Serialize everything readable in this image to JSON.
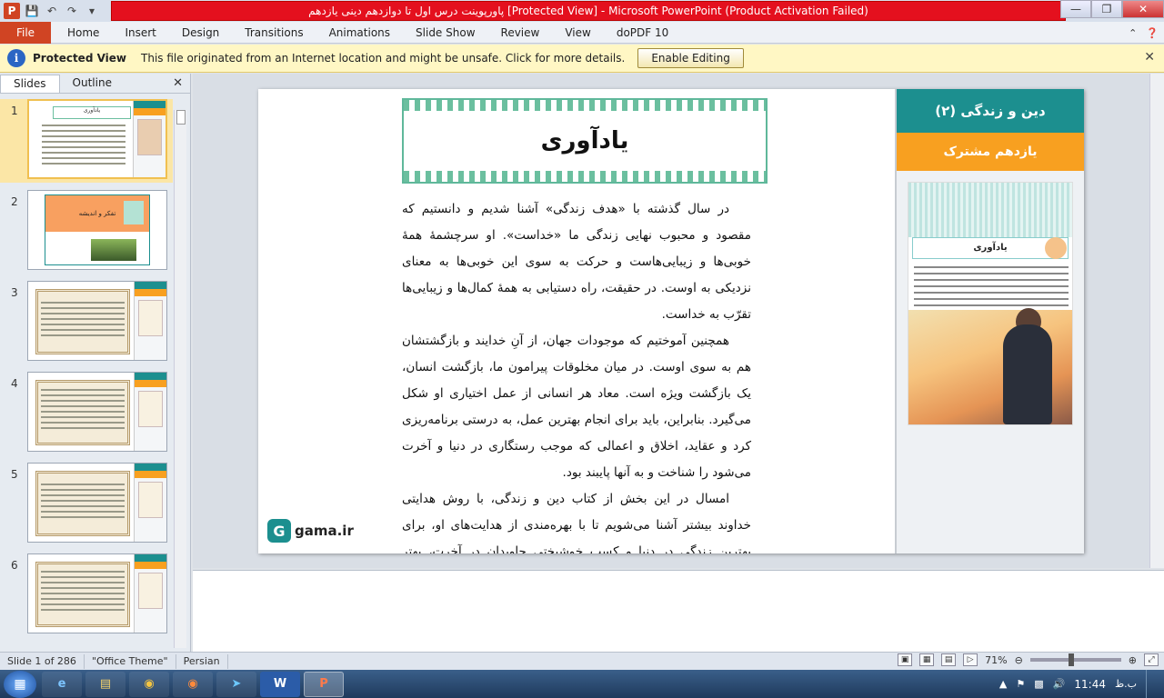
{
  "window": {
    "title": "پاورپوینت درس اول تا دوازدهم دینی یازدهم [Protected View] - Microsoft PowerPoint (Product Activation Failed)"
  },
  "qat": {
    "app_icon": "P"
  },
  "ribbon": {
    "tabs": [
      "File",
      "Home",
      "Insert",
      "Design",
      "Transitions",
      "Animations",
      "Slide Show",
      "Review",
      "View",
      "doPDF 10"
    ]
  },
  "protected_view": {
    "label": "Protected View",
    "message": "This file originated from an Internet location and might be unsafe. Click for more details.",
    "button": "Enable Editing"
  },
  "left_panel": {
    "tabs": [
      "Slides",
      "Outline"
    ],
    "thumb2_title": "تفکر و اندیشه",
    "slide_numbers": [
      "1",
      "2",
      "3",
      "4",
      "5",
      "6"
    ]
  },
  "slide": {
    "title": "یادآوری",
    "side_title": "دین و زندگی (۲)",
    "side_subtitle": "یازدهم مشترک",
    "pic_title": "یادآوری",
    "paragraphs": [
      "در سال گذشته با «هدف زندگی» آشنا شدیم و دانستیم که مقصود و محبوب نهایی زندگی ما «خداست». او سرچشمهٔ همهٔ خوبی‌ها و زیبایی‌هاست و حرکت به سوی این خوبی‌ها به معنای نزدیکی به اوست. در حقیقت، راه دستیابی به همهٔ کمال‌ها و زیبایی‌ها تقرّب به خداست.",
      "همچنین آموختیم که موجودات جهان، از آنِ خدایند و بازگشتشان هم به سوی اوست. در میان مخلوقات پیرامون ما، بازگشت انسان، یک بازگشت ویژه است. معاد هر انسانی از عمل اختیاری او شکل می‌گیرد. بنابراین، باید برای انجام بهترین عمل، به درستی برنامه‌ریزی کرد و عقاید، اخلاق و اعمالی که موجب رستگاری در دنیا و آخرت می‌شود را شناخت و به آنها پایبند بود.",
      "امسال در این بخش از کتاب دین و زندگی، با روش هدایتی خداوند بیشتر آشنا می‌شویم تا با بهره‌مندی از هدایت‌های او، برای بهترین زندگی در دنیا و کسب خوشبختی جاویدان در آخرت، بهتر برنامه‌ریزی کنیم."
    ],
    "logo_text": "gama.ir"
  },
  "status": {
    "slide_info": "Slide 1 of 286",
    "theme": "\"Office Theme\"",
    "language": "Persian",
    "zoom": "71%",
    "zoom_fraction": 0.45
  },
  "taskbar": {
    "clock": "11:44",
    "ampm": "ب.ظ"
  },
  "colors": {
    "accent_teal": "#1c8f8f",
    "accent_orange": "#f8a020",
    "title_red": "#e4101e",
    "file_tab": "#d04423"
  }
}
